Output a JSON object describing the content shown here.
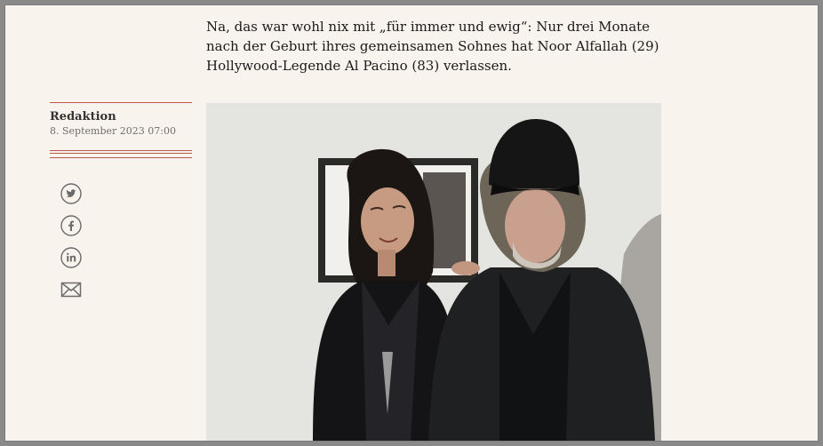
{
  "article": {
    "lead": "Na, das war wohl nix mit „für immer und ewig“: Nur drei Monate nach der Geburt ihres gemeinsamen Sohnes hat Noor Alfallah (29) Hollywood-Legende Al Pacino (83) verlassen."
  },
  "byline": {
    "author": "Redaktion",
    "date": "8. September 2023 07:00"
  },
  "share": {
    "icons": [
      "twitter-icon",
      "facebook-icon",
      "linkedin-icon",
      "email-icon"
    ]
  },
  "colors": {
    "page_background": "#f9f3ee",
    "accent_rule": "#b75b4a",
    "icon_gray": "#6b6b6b"
  }
}
